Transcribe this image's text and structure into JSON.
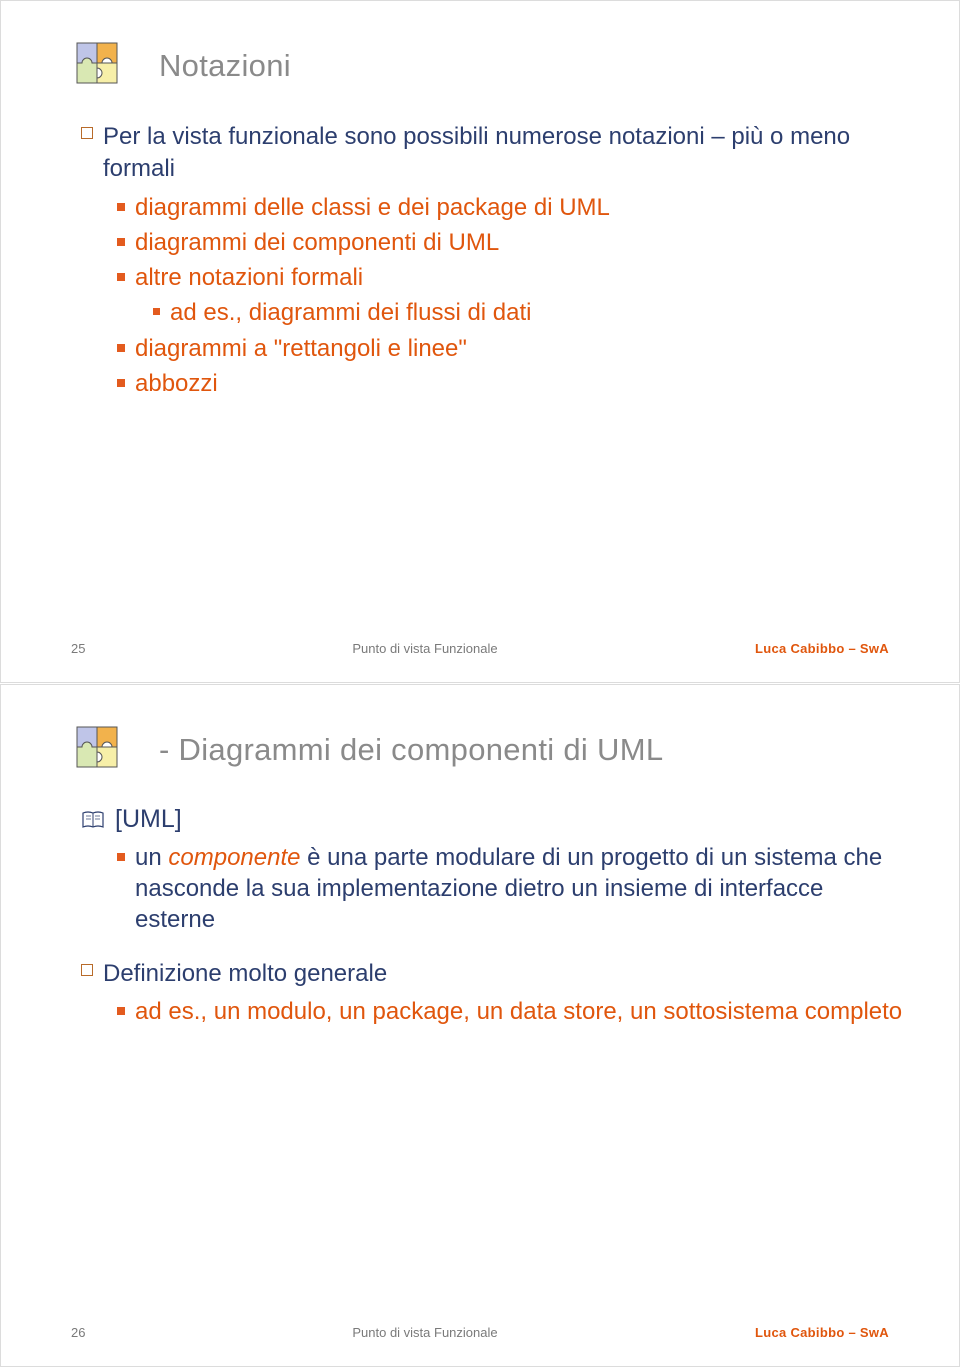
{
  "slide1": {
    "title": "Notazioni",
    "b1": "Per la vista funzionale sono possibili numerose notazioni – più o meno formali",
    "b1_1": "diagrammi delle classi e dei package di UML",
    "b1_2": "diagrammi dei componenti di UML",
    "b1_3": "altre notazioni formali",
    "b1_3_1": "ad es., diagrammi dei flussi di dati",
    "b1_4": "diagrammi a \"rettangoli e linee\"",
    "b1_5": "abbozzi",
    "page": "25",
    "center": "Punto di vista Funzionale",
    "author": "Luca Cabibbo – SwA"
  },
  "slide2": {
    "title": "- Diagrammi dei componenti di UML",
    "ref": "[UML]",
    "r1_pre": "un ",
    "r1_em": "componente",
    "r1_post": " è una parte modulare di un progetto di un sistema che nasconde la sua implementazione dietro un insieme di interfacce esterne",
    "b2": "Definizione molto generale",
    "b2_1": "ad es., un modulo, un package, un data store, un sottosistema completo",
    "page": "26",
    "center": "Punto di vista Funzionale",
    "author": "Luca Cabibbo – SwA"
  }
}
